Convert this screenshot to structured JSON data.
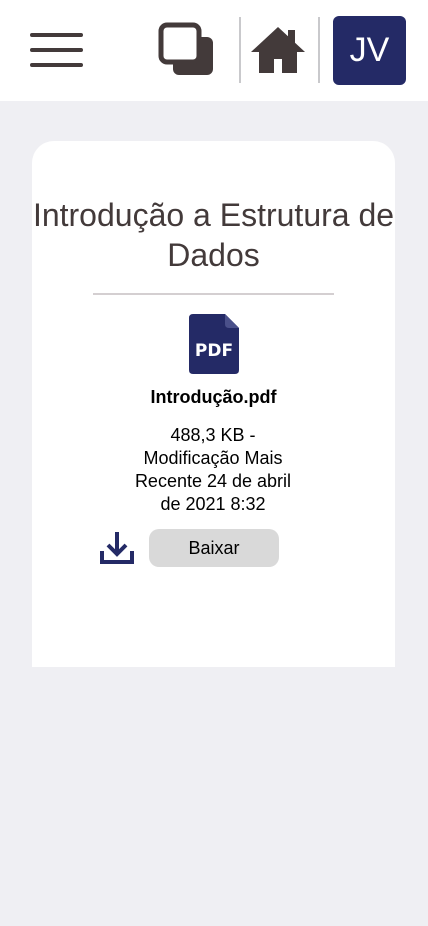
{
  "header": {
    "avatar_initials": "JV",
    "icons": {
      "menu": "hamburger-menu-icon",
      "switch": "switch-windows-icon",
      "home": "home-icon"
    },
    "colors": {
      "icon": "#433a3a",
      "avatar_bg": "#242a66"
    }
  },
  "card": {
    "title": "Introdução a Estrutura de Dados",
    "file": {
      "icon": "pdf-file-icon",
      "icon_label": "PDF",
      "name": "Introdução.pdf",
      "meta": "488,3 KB - Modificação Mais Recente 24 de abril de 2021 8:32",
      "download_label": "Baixar"
    }
  },
  "colors": {
    "page_bg": "#efeff3",
    "accent": "#242a66",
    "button_bg": "#d9d9d9",
    "title_text": "#433a3a"
  }
}
